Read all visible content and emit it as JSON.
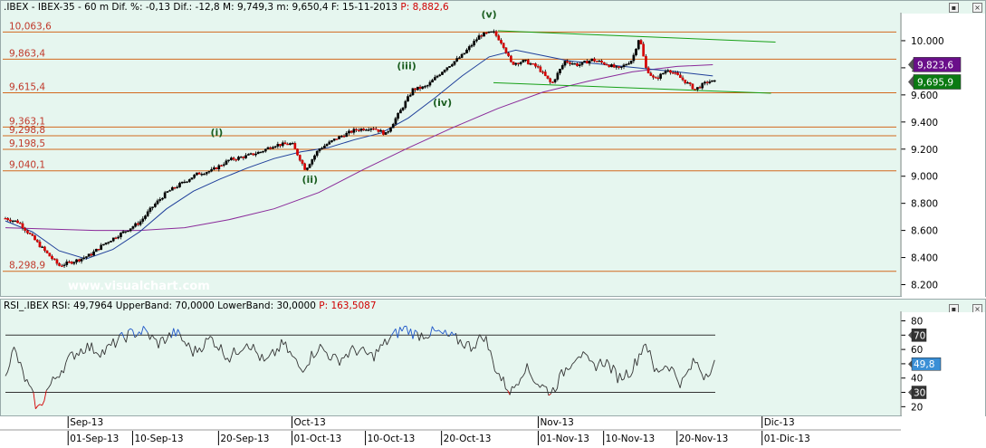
{
  "header_main": {
    "symbol": ".IBEX - IBEX-35 -",
    "stats": "60 m Dif. %: -0,13 Dif.: -12,8 M: 9,749,3 m: 9,650,4 F: 15-11-2013",
    "p": "P: 8,882,6"
  },
  "header_rsi": {
    "text": "RSI_.IBEX RSI: 49,7964 UpperBand: 70,0000 LowerBand: 30,0000",
    "p": "P: 163,5087"
  },
  "watermark": "www.visualchart.com",
  "colors": {
    "panel_bg": "#e6f6ef",
    "fib": "#d2691e",
    "fib_label": "#c0392b",
    "trend": "#16a016",
    "ma_fast": "#1f3f9a",
    "ma_slow": "#8a2a9a",
    "candle_up": "#000000",
    "candle_down": "#d40000",
    "rsi_line": "#333333",
    "rsi_over": "#1e56c8",
    "rsi_under": "#d40000",
    "tag_purple": "#6a0f8a",
    "tag_green": "#0b7a12",
    "tag_rsi": "#3a8fd6"
  },
  "chart_data": [
    {
      "type": "candlestick",
      "title": ".IBEX - IBEX-35 - 60 m",
      "ylim": [
        8150,
        10180
      ],
      "y_ticks": [
        {
          "v": 10000,
          "label": "10.000"
        },
        {
          "v": 9800,
          "label": "9.800"
        },
        {
          "v": 9600,
          "label": "9.600"
        },
        {
          "v": 9400,
          "label": "9.400"
        },
        {
          "v": 9200,
          "label": "9.200"
        },
        {
          "v": 9000,
          "label": "9.000"
        },
        {
          "v": 8800,
          "label": "8.800"
        },
        {
          "v": 8600,
          "label": "8.600"
        },
        {
          "v": 8400,
          "label": "8.400"
        },
        {
          "v": 8200,
          "label": "8.200"
        }
      ],
      "fib_levels": [
        {
          "v": 10063.6,
          "label": "10,063,6"
        },
        {
          "v": 9863.4,
          "label": "9,863,4"
        },
        {
          "v": 9615.4,
          "label": "9,615,4"
        },
        {
          "v": 9363.1,
          "label": "9,363,1"
        },
        {
          "v": 9298.8,
          "label": "9,298,8"
        },
        {
          "v": 9198.5,
          "label": "9,198,5"
        },
        {
          "v": 9040.1,
          "label": "9,040,1"
        },
        {
          "v": 8298.9,
          "label": "8,298,9"
        }
      ],
      "wave_labels": [
        {
          "label": "(i)",
          "x": 0.236,
          "v": 9298
        },
        {
          "label": "(ii)",
          "x": 0.34,
          "v": 8950
        },
        {
          "label": "(iii)",
          "x": 0.448,
          "v": 9790
        },
        {
          "label": "(iv)",
          "x": 0.488,
          "v": 9520
        },
        {
          "label": "(v)",
          "x": 0.54,
          "v": 10170
        }
      ],
      "trend_lines": [
        {
          "x1": 0.55,
          "v1": 10073,
          "x2": 0.86,
          "v2": 9990
        },
        {
          "x1": 0.545,
          "v1": 9690,
          "x2": 0.855,
          "v2": 9612
        }
      ],
      "price_path": [
        [
          0.0,
          8690
        ],
        [
          0.015,
          8660
        ],
        [
          0.03,
          8550
        ],
        [
          0.045,
          8440
        ],
        [
          0.06,
          8340
        ],
        [
          0.08,
          8380
        ],
        [
          0.095,
          8420
        ],
        [
          0.11,
          8500
        ],
        [
          0.13,
          8580
        ],
        [
          0.15,
          8660
        ],
        [
          0.165,
          8780
        ],
        [
          0.18,
          8880
        ],
        [
          0.2,
          8960
        ],
        [
          0.215,
          9020
        ],
        [
          0.23,
          9040
        ],
        [
          0.25,
          9120
        ],
        [
          0.27,
          9150
        ],
        [
          0.285,
          9180
        ],
        [
          0.3,
          9230
        ],
        [
          0.32,
          9240
        ],
        [
          0.335,
          9050
        ],
        [
          0.35,
          9200
        ],
        [
          0.37,
          9280
        ],
        [
          0.39,
          9340
        ],
        [
          0.41,
          9360
        ],
        [
          0.425,
          9310
        ],
        [
          0.44,
          9470
        ],
        [
          0.455,
          9640
        ],
        [
          0.47,
          9660
        ],
        [
          0.49,
          9790
        ],
        [
          0.51,
          9890
        ],
        [
          0.53,
          10040
        ],
        [
          0.545,
          10063
        ],
        [
          0.555,
          9980
        ],
        [
          0.565,
          9830
        ],
        [
          0.58,
          9850
        ],
        [
          0.595,
          9800
        ],
        [
          0.61,
          9680
        ],
        [
          0.625,
          9850
        ],
        [
          0.64,
          9820
        ],
        [
          0.655,
          9860
        ],
        [
          0.67,
          9830
        ],
        [
          0.685,
          9790
        ],
        [
          0.7,
          9860
        ],
        [
          0.708,
          10030
        ],
        [
          0.715,
          9800
        ],
        [
          0.725,
          9710
        ],
        [
          0.74,
          9790
        ],
        [
          0.755,
          9720
        ],
        [
          0.77,
          9640
        ],
        [
          0.785,
          9700
        ],
        [
          0.792,
          9695
        ]
      ],
      "ma_fast": [
        [
          0.0,
          8670
        ],
        [
          0.03,
          8590
        ],
        [
          0.06,
          8450
        ],
        [
          0.09,
          8390
        ],
        [
          0.12,
          8460
        ],
        [
          0.15,
          8590
        ],
        [
          0.18,
          8760
        ],
        [
          0.21,
          8890
        ],
        [
          0.24,
          8980
        ],
        [
          0.27,
          9060
        ],
        [
          0.3,
          9130
        ],
        [
          0.33,
          9180
        ],
        [
          0.36,
          9210
        ],
        [
          0.39,
          9270
        ],
        [
          0.42,
          9320
        ],
        [
          0.45,
          9430
        ],
        [
          0.48,
          9580
        ],
        [
          0.51,
          9740
        ],
        [
          0.54,
          9880
        ],
        [
          0.57,
          9930
        ],
        [
          0.6,
          9890
        ],
        [
          0.63,
          9850
        ],
        [
          0.66,
          9830
        ],
        [
          0.69,
          9810
        ],
        [
          0.72,
          9790
        ],
        [
          0.75,
          9770
        ],
        [
          0.79,
          9740
        ]
      ],
      "ma_slow": [
        [
          0.0,
          8620
        ],
        [
          0.05,
          8610
        ],
        [
          0.1,
          8600
        ],
        [
          0.15,
          8600
        ],
        [
          0.2,
          8620
        ],
        [
          0.25,
          8680
        ],
        [
          0.3,
          8760
        ],
        [
          0.35,
          8880
        ],
        [
          0.4,
          9050
        ],
        [
          0.45,
          9210
        ],
        [
          0.5,
          9360
        ],
        [
          0.55,
          9500
        ],
        [
          0.6,
          9620
        ],
        [
          0.65,
          9700
        ],
        [
          0.7,
          9770
        ],
        [
          0.75,
          9810
        ],
        [
          0.79,
          9823
        ]
      ],
      "price_tags": [
        {
          "label": "9,823,6",
          "v": 9823.6,
          "style": "purple"
        },
        {
          "label": "9,695,9",
          "v": 9695.9,
          "style": "green"
        }
      ],
      "x_axis": {
        "months": [
          {
            "label": "Sep-13",
            "x": 0.07
          },
          {
            "label": "Oct-13",
            "x": 0.32
          },
          {
            "label": "Nov-13",
            "x": 0.595
          },
          {
            "label": "Dic-13",
            "x": 0.845
          }
        ],
        "dates": [
          {
            "label": "01-Sep-13",
            "x": 0.07
          },
          {
            "label": "10-Sep-13",
            "x": 0.142
          },
          {
            "label": "20-Sep-13",
            "x": 0.238
          },
          {
            "label": "01-Oct-13",
            "x": 0.32
          },
          {
            "label": "10-Oct-13",
            "x": 0.402
          },
          {
            "label": "20-Oct-13",
            "x": 0.487
          },
          {
            "label": "01-Nov-13",
            "x": 0.595
          },
          {
            "label": "10-Nov-13",
            "x": 0.668
          },
          {
            "label": "20-Nov-13",
            "x": 0.75
          },
          {
            "label": "01-Dic-13",
            "x": 0.845
          }
        ]
      }
    },
    {
      "type": "line",
      "title": "RSI_.IBEX RSI",
      "ylim": [
        12,
        86
      ],
      "y_ticks": [
        {
          "v": 80,
          "label": "80"
        },
        {
          "v": 70,
          "label": "70"
        },
        {
          "v": 60,
          "label": "60"
        },
        {
          "v": 50,
          "label": "50"
        },
        {
          "v": 40,
          "label": "40"
        },
        {
          "v": 30,
          "label": "30"
        },
        {
          "v": 20,
          "label": "20"
        }
      ],
      "bands": {
        "upper": 70,
        "lower": 30
      },
      "tags": [
        {
          "label": "70",
          "v": 70,
          "style": "band"
        },
        {
          "label": "49,8",
          "v": 49.8,
          "style": "rsi"
        },
        {
          "label": "30",
          "v": 30,
          "style": "band"
        }
      ],
      "series_path": [
        [
          0.0,
          45
        ],
        [
          0.01,
          60
        ],
        [
          0.02,
          42
        ],
        [
          0.03,
          28
        ],
        [
          0.037,
          17
        ],
        [
          0.045,
          30
        ],
        [
          0.06,
          44
        ],
        [
          0.075,
          56
        ],
        [
          0.09,
          62
        ],
        [
          0.11,
          58
        ],
        [
          0.125,
          66
        ],
        [
          0.14,
          71
        ],
        [
          0.155,
          73
        ],
        [
          0.17,
          64
        ],
        [
          0.19,
          72
        ],
        [
          0.21,
          58
        ],
        [
          0.23,
          68
        ],
        [
          0.25,
          54
        ],
        [
          0.27,
          66
        ],
        [
          0.29,
          50
        ],
        [
          0.31,
          64
        ],
        [
          0.33,
          46
        ],
        [
          0.35,
          62
        ],
        [
          0.37,
          52
        ],
        [
          0.39,
          60
        ],
        [
          0.41,
          55
        ],
        [
          0.43,
          68
        ],
        [
          0.445,
          75
        ],
        [
          0.46,
          70
        ],
        [
          0.48,
          72
        ],
        [
          0.5,
          68
        ],
        [
          0.52,
          62
        ],
        [
          0.535,
          70
        ],
        [
          0.545,
          50
        ],
        [
          0.555,
          38
        ],
        [
          0.565,
          30
        ],
        [
          0.58,
          48
        ],
        [
          0.595,
          36
        ],
        [
          0.61,
          30
        ],
        [
          0.625,
          46
        ],
        [
          0.64,
          58
        ],
        [
          0.655,
          48
        ],
        [
          0.67,
          52
        ],
        [
          0.685,
          40
        ],
        [
          0.7,
          46
        ],
        [
          0.715,
          66
        ],
        [
          0.725,
          44
        ],
        [
          0.74,
          50
        ],
        [
          0.755,
          36
        ],
        [
          0.77,
          52
        ],
        [
          0.78,
          42
        ],
        [
          0.792,
          50
        ]
      ]
    }
  ]
}
